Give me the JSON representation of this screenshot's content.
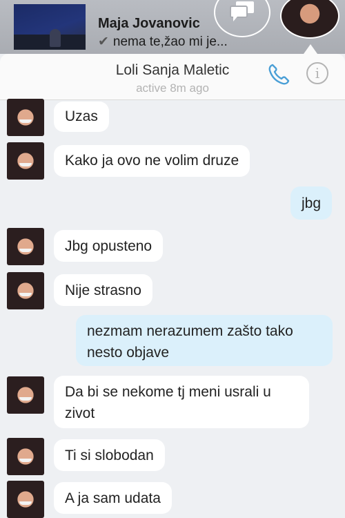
{
  "notification": {
    "sender": "Maja Jovanovic",
    "message": "nema te,žao mi je...",
    "check": "✔"
  },
  "header": {
    "contact_name": "Loli Sanja Maletic",
    "status": "active 8m ago"
  },
  "messages": [
    {
      "from": "them",
      "text": "Uzas"
    },
    {
      "from": "them",
      "text": "Kako ja ovo ne volim druze"
    },
    {
      "from": "me",
      "text": "jbg"
    },
    {
      "from": "them",
      "text": "Jbg opusteno"
    },
    {
      "from": "them",
      "text": "Nije strasno"
    },
    {
      "from": "me",
      "lines": [
        "nezmam nerazumem zašto tako",
        "nesto objave"
      ]
    },
    {
      "from": "them",
      "lines": [
        "Da bi se nekome tj meni usrali u",
        "zivot"
      ]
    },
    {
      "from": "them",
      "text": "Ti si slobodan"
    },
    {
      "from": "them",
      "text": "A ja sam udata"
    }
  ],
  "colors": {
    "accent": "#4a9fd6",
    "sent_bubble": "#dbf0fb",
    "received_bubble": "#ffffff"
  }
}
